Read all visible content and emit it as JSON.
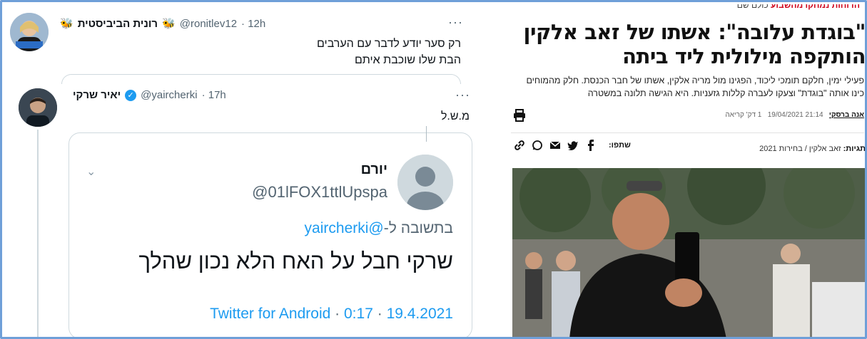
{
  "tweet1": {
    "display_name": "רונית הביביסטית",
    "handle": "@ronitlev12",
    "time": "· 12h",
    "more_label": "···",
    "text_lines": [
      "רק סער יודע לדבר עם הערבים",
      "הבת שלו שוכבת איתם"
    ]
  },
  "tweet2": {
    "display_name": "יאיר שרקי",
    "handle": "@yaircherki",
    "time": "· 17h",
    "more_label": "···",
    "text": "מ.ש.ל"
  },
  "quote": {
    "display_name": "יורם",
    "handle": "@01lFOX1ttlUpspa",
    "reply_prefix": "בתשובה ל-",
    "reply_mention": "@yaircherki",
    "text": "שרקי חבל על האח הלא נכון שהלך",
    "client": "Twitter for Android",
    "time": "0:17",
    "date": "19.4.2021",
    "sep": "·"
  },
  "article": {
    "kicker_red": "הדוחות נמחקו מהשבוע",
    "kicker_rest": " כולם שם",
    "headline": "\"בוגדת עלובה\": אשתו של זאב אלקין הותקפה מילולית ליד ביתה",
    "summary": "פעילי ימין, חלקם תומכי ליכוד, הפגינו מול מריה אלקין, אשתו של חבר הכנסת. חלק מהמוחים כינו אותה \"בוגדת\" וצעקו לעברה קללות גזעניות. היא הגישה תלונה במשטרה",
    "author": "אנה ברסקי",
    "datetime": "21:14 19/04/2021",
    "read_time": "1 דק' קריאה",
    "share_label": "שתפו:",
    "tags_label": "תגיות:",
    "tags": "זאב אלקין / בחירות 2021"
  },
  "colors": {
    "twitter_blue": "#1d9bf0",
    "frame_border": "#6f9fd8",
    "news_red": "#d0021b"
  }
}
